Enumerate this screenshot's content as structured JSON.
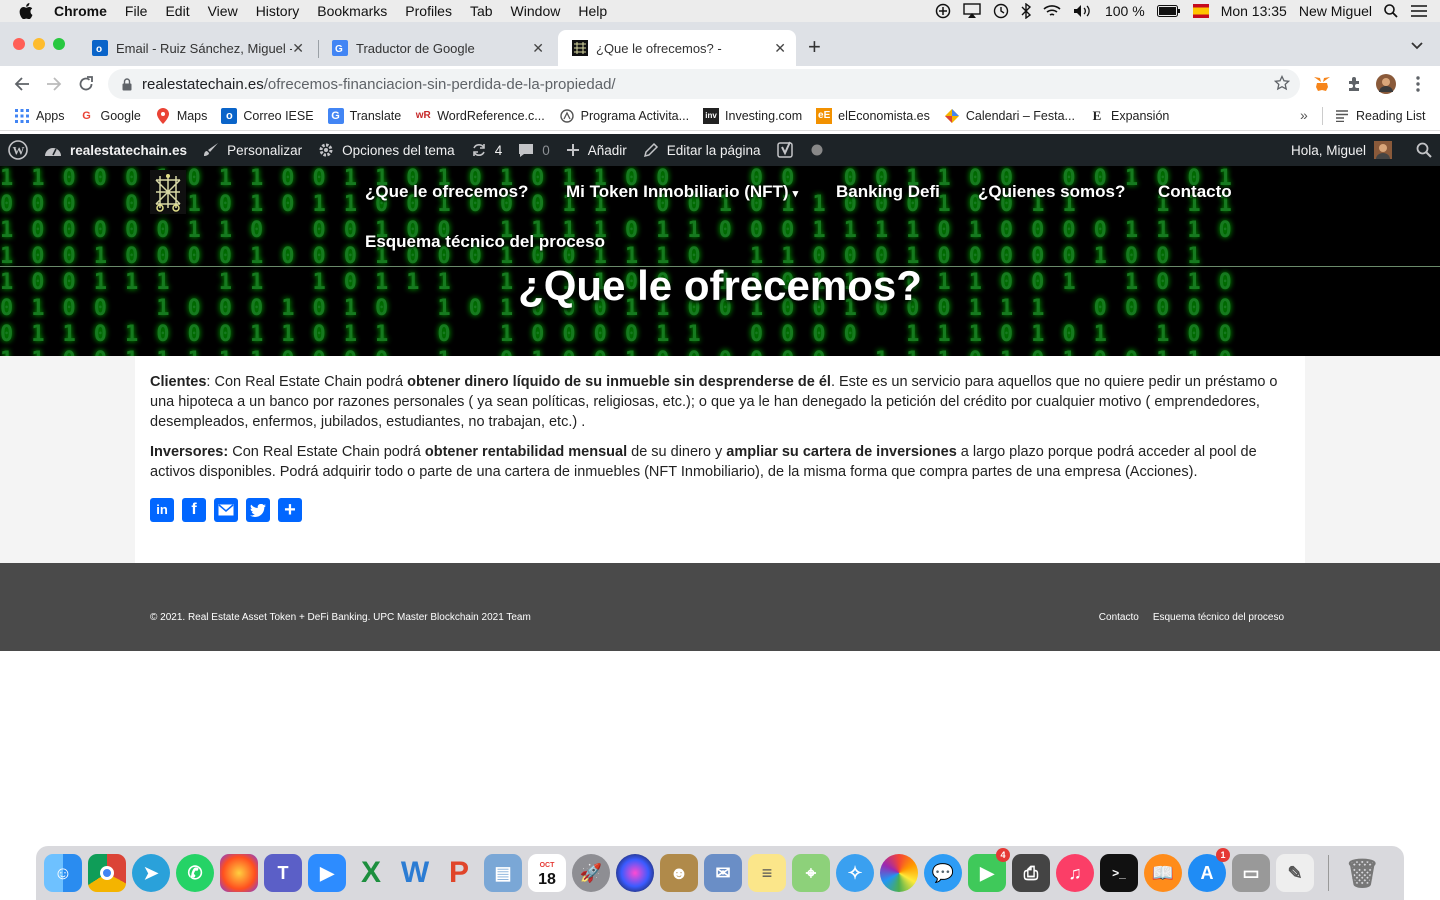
{
  "menubar": {
    "app": "Chrome",
    "items": [
      "File",
      "Edit",
      "View",
      "History",
      "Bookmarks",
      "Profiles",
      "Tab",
      "Window",
      "Help"
    ],
    "battery": "100 %",
    "clock": "Mon 13:35",
    "user": "New Miguel"
  },
  "tabs": [
    {
      "title": "Email - Ruiz Sánchez, Miguel -",
      "icon": "outlook-icon"
    },
    {
      "title": "Traductor de Google",
      "icon": "google-translate-icon"
    },
    {
      "title": "¿Que le ofrecemos? -",
      "icon": "site-logo-icon",
      "active": true
    }
  ],
  "address": {
    "domain": "realestatechain.es",
    "path": "/ofrecemos-financiacion-sin-perdida-de-la-propiedad/"
  },
  "bookmarks": [
    {
      "label": "Apps",
      "icon": "apps-grid-icon"
    },
    {
      "label": "Google",
      "icon": "google-icon"
    },
    {
      "label": "Maps",
      "icon": "maps-icon"
    },
    {
      "label": "Correo IESE",
      "icon": "outlook-icon"
    },
    {
      "label": "Translate",
      "icon": "google-translate-icon"
    },
    {
      "label": "WordReference.c...",
      "icon": "wordreference-icon"
    },
    {
      "label": "Programa Activita...",
      "icon": "activita-icon"
    },
    {
      "label": "Investing.com",
      "icon": "investing-icon"
    },
    {
      "label": "elEconomista.es",
      "icon": "eleconomista-icon"
    },
    {
      "label": "Calendari – Festa...",
      "icon": "calendar-icon"
    },
    {
      "label": "Expansión",
      "icon": "expansion-icon"
    }
  ],
  "reading_list": "Reading List",
  "wp_admin": {
    "site": "realestatechain.es",
    "customize": "Personalizar",
    "theme_options": "Opciones del tema",
    "updates": "4",
    "comments": "0",
    "add": "Añadir",
    "edit_page": "Editar la página",
    "greeting": "Hola, Miguel"
  },
  "site_nav": {
    "items": [
      "¿Que le ofrecemos?",
      "Mi Token Inmobiliario (NFT)",
      "Banking Defi",
      "¿Quienes somos?",
      "Contacto",
      "Esquema técnico del proceso"
    ]
  },
  "page_title": "¿Que le ofrecemos?",
  "content": {
    "p1_label": "Clientes",
    "p1_a": ": Con Real Estate Chain podrá ",
    "p1_bold": "obtener dinero líquido de su inmueble sin desprenderse de él",
    "p1_b": ". Este es un servicio para aquellos que no quiere pedir un préstamo o una hipoteca a un banco por razones personales ( ya sean políticas, religiosas, etc.); o que ya le han denegado la petición del crédito por cualquier motivo ( emprendedores, desempleados, enfermos, jubilados, estudiantes, no trabajan, etc.) .",
    "p2_label": "Inversores:",
    "p2_a": " Con Real Estate Chain podrá ",
    "p2_bold1": "obtener rentabilidad mensual",
    "p2_b": " de su dinero y ",
    "p2_bold2": "ampliar su cartera de inversiones",
    "p2_c": " a largo plazo porque podrá acceder al pool de activos disponibles. Podrá adquirir todo o parte de una cartera de inmuebles (NFT Inmobiliario), de la misma forma que compra partes de una empresa (Acciones)."
  },
  "share": [
    "linkedin-icon",
    "facebook-icon",
    "email-icon",
    "twitter-icon",
    "share-icon"
  ],
  "footer": {
    "copyright": "© 2021. Real Estate Asset Token + DeFi Banking. UPC Master Blockchain 2021 Team",
    "links": [
      "Contacto",
      "Esquema técnico del proceso"
    ]
  },
  "dock": {
    "calendar_month": "OCT",
    "calendar_day": "18",
    "facetime_badge": "4",
    "appstore_badge": "1"
  }
}
